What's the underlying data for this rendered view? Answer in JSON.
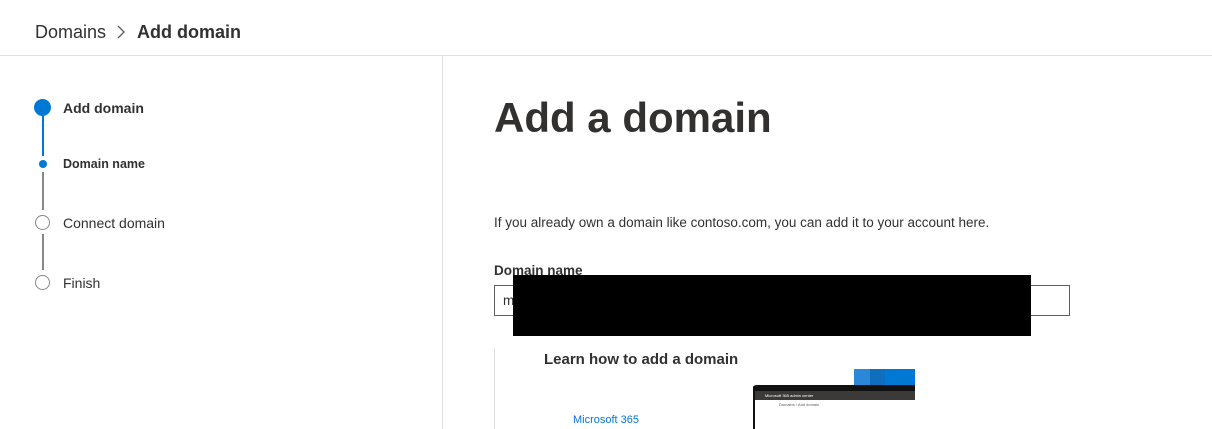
{
  "breadcrumb": {
    "root": "Domains",
    "current": "Add domain"
  },
  "steps": [
    {
      "label": "Add domain",
      "state": "active"
    },
    {
      "label": "Domain name",
      "state": "current-substep"
    },
    {
      "label": "Connect domain",
      "state": "pending"
    },
    {
      "label": "Finish",
      "state": "pending"
    }
  ],
  "main": {
    "title": "Add a domain",
    "intro": "If you already own a domain like contoso.com, you can add it to your account here.",
    "field_label": "Domain name",
    "field_value": "m",
    "learn": {
      "title": "Learn how to add a domain",
      "thumb_bar_text": "Microsoft 365 admin center",
      "thumb_page_text": "Domains  /  Add domain",
      "link": "Microsoft 365"
    }
  },
  "colors": {
    "accent": "#0078d4",
    "step_pending": "#8a8886",
    "input_autofill": "#fdf6c3"
  }
}
